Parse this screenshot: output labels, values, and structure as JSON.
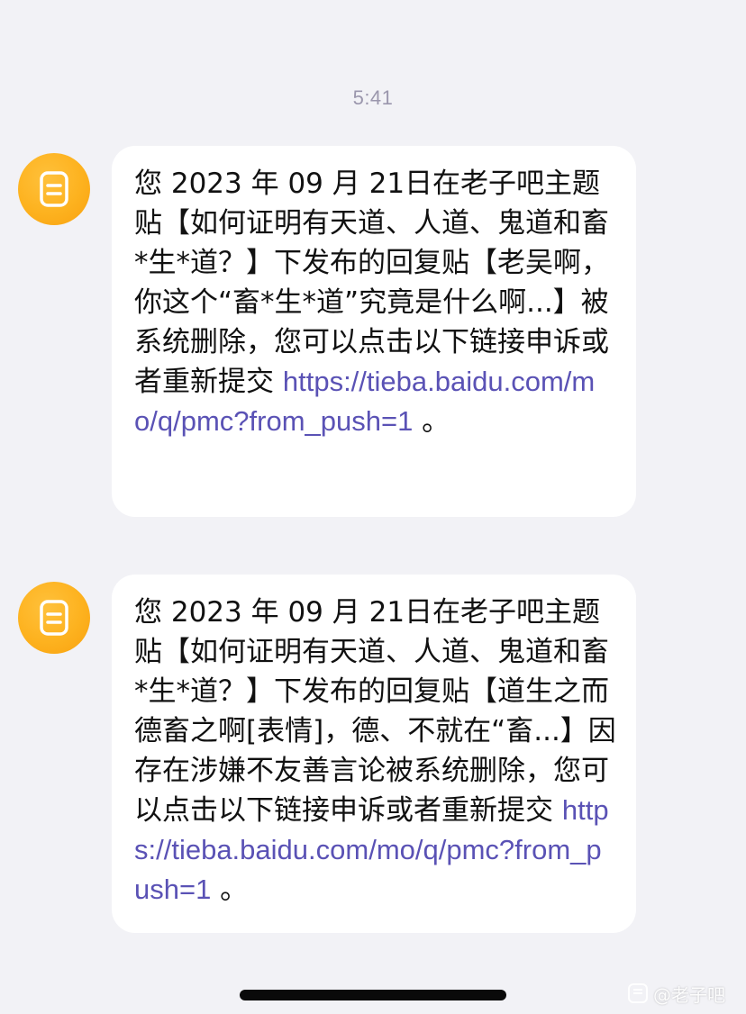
{
  "thread": {
    "timestamp": "5:41",
    "sender_icon": "notes-icon",
    "accent_color": "#fbae1a",
    "link_color": "#5a52b5"
  },
  "messages": [
    {
      "text": "您 2023 年 09 月 21日在老子吧主题贴【如何证明有天道、人道、鬼道和畜*生*道？】下发布的回复贴【老吴啊，你这个“畜*生*道”究竟是什么啊...】被系统删除，您可以点击以下链接申诉或者重新提交 ",
      "link": "https://tieba.baidu.com/mo/q/pmc?from_push=1",
      "suffix": " 。"
    },
    {
      "text": "您 2023 年 09 月 21日在老子吧主题贴【如何证明有天道、人道、鬼道和畜*生*道？】下发布的回复贴【道生之而德畜之啊[表情]，德、不就在“畜...】因存在涉嫌不友善言论被系统删除，您可以点击以下链接申诉或者重新提交 ",
      "link": "https://tieba.baidu.com/mo/q/pmc?from_push=1",
      "suffix": " 。"
    }
  ],
  "watermark": {
    "text": "@老子吧",
    "icon": "tieba-icon"
  }
}
